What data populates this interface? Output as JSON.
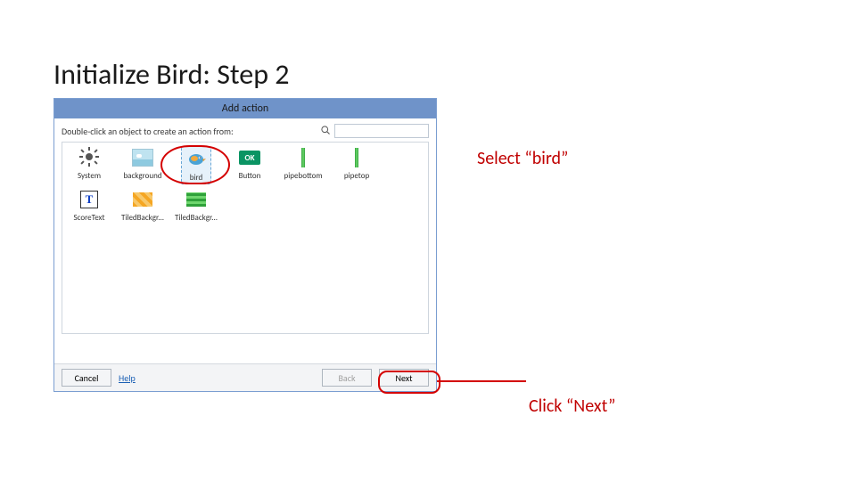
{
  "slide": {
    "title": "Initialize Bird: Step 2"
  },
  "dialog": {
    "title": "Add action",
    "instruction": "Double-click an object to create an action from:",
    "search": {
      "placeholder": ""
    },
    "objects": [
      {
        "label": "System"
      },
      {
        "label": "background"
      },
      {
        "label": "bird"
      },
      {
        "label": "Button"
      },
      {
        "label": "pipebottom"
      },
      {
        "label": "pipetop"
      },
      {
        "label": "ScoreText"
      },
      {
        "label": "TiledBackgr..."
      },
      {
        "label": "TiledBackgr..."
      }
    ],
    "footer": {
      "cancel": "Cancel",
      "help": "Help",
      "back": "Back",
      "next": "Next"
    }
  },
  "annotations": {
    "select_bird": "Select “bird”",
    "click_next": "Click “Next”"
  },
  "icons": {
    "ok": "OK",
    "text_glyph": "T"
  }
}
